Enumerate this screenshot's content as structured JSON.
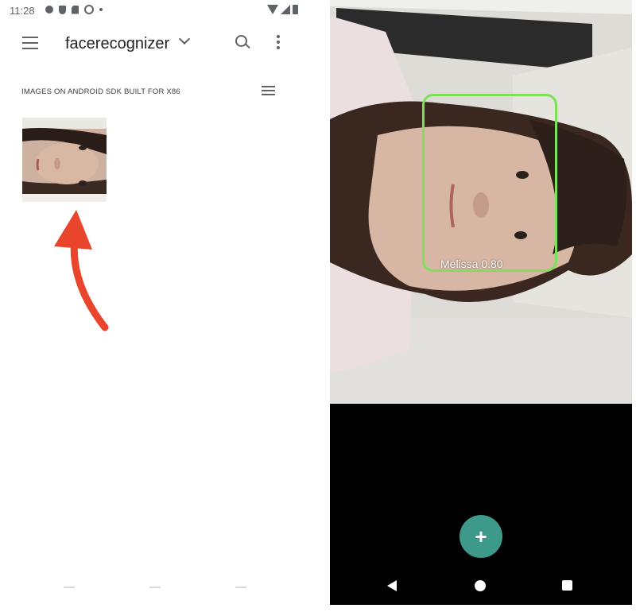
{
  "status_bar": {
    "time": "11:28",
    "icons": [
      "gear-icon",
      "shield-icon",
      "sd-card-icon",
      "sync-icon",
      "dot-icon",
      "wifi-icon",
      "signal-icon",
      "battery-icon"
    ]
  },
  "app_bar": {
    "title": "facerecognizer",
    "icons": [
      "menu-icon",
      "chevron-down-icon",
      "search-icon",
      "more-vert-icon"
    ]
  },
  "gallery": {
    "section_label": "IMAGES ON ANDROID SDK BUILT FOR X86",
    "view_toggle_icon": "list-view-icon",
    "item_count": 1
  },
  "camera_view": {
    "detection_label": "Melissa 0.80",
    "box_color": "#7ee05a"
  },
  "fab": {
    "label": "+",
    "color": "#3d9a8b"
  },
  "nav_bar": {
    "icons": [
      "back-icon",
      "home-icon",
      "recents-icon"
    ]
  },
  "colors": {
    "annotation_arrow": "#e8452c"
  }
}
